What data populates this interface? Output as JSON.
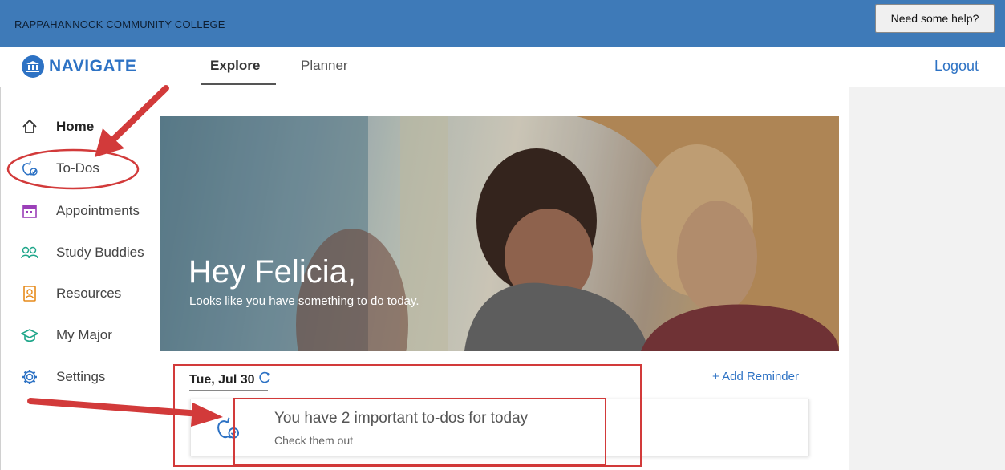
{
  "header": {
    "college": "RAPPAHANNOCK COMMUNITY COLLEGE",
    "help_label": "Need some help?"
  },
  "nav": {
    "logo_text": "NAVIGATE",
    "tabs": [
      {
        "label": "Explore"
      },
      {
        "label": "Planner"
      }
    ],
    "logout": "Logout"
  },
  "sidebar": {
    "items": [
      {
        "label": "Home",
        "icon": "home-icon"
      },
      {
        "label": "To-Dos",
        "icon": "apple-check-icon"
      },
      {
        "label": "Appointments",
        "icon": "calendar-icon"
      },
      {
        "label": "Study Buddies",
        "icon": "people-icon"
      },
      {
        "label": "Resources",
        "icon": "contact-book-icon"
      },
      {
        "label": "My Major",
        "icon": "graduation-cap-icon"
      },
      {
        "label": "Settings",
        "icon": "gear-icon"
      }
    ]
  },
  "hero": {
    "greeting": "Hey Felicia,",
    "subtitle": "Looks like you have something to do today."
  },
  "today": {
    "date": "Tue, Jul 30",
    "add_reminder": "Add Reminder"
  },
  "todo_card": {
    "title": "You have 2 important to-dos for today",
    "subtitle": "Check them out"
  },
  "colors": {
    "header_blue": "#3e7ab8",
    "brand_blue": "#2d72c4",
    "annotation_red": "#d23a3a"
  }
}
